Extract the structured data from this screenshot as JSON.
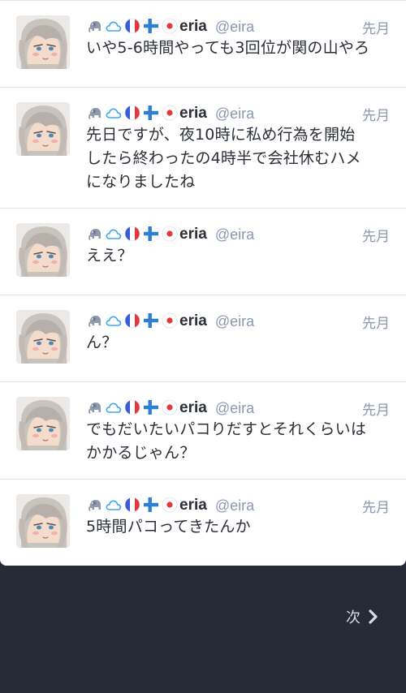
{
  "posts": [
    {
      "display_name": "eria",
      "account": "@eira",
      "time": "先月",
      "lines": [
        "いや5-6時間やっても3回位が関の山やろ"
      ],
      "emojis": [
        "elephant-icon",
        "cloud-icon",
        "france-flag-icon",
        "finland-flag-icon",
        "japan-flag-icon"
      ]
    },
    {
      "display_name": "eria",
      "account": "@eira",
      "time": "先月",
      "lines": [
        "先日ですが、夜10時に私め行為を開始",
        "したら終わったの4時半で会社休むハメ",
        "になりましたね"
      ],
      "emojis": [
        "elephant-icon",
        "cloud-icon",
        "france-flag-icon",
        "finland-flag-icon",
        "japan-flag-icon"
      ]
    },
    {
      "display_name": "eria",
      "account": "@eira",
      "time": "先月",
      "lines": [
        "ええ？"
      ],
      "emojis": [
        "elephant-icon",
        "cloud-icon",
        "france-flag-icon",
        "finland-flag-icon",
        "japan-flag-icon"
      ]
    },
    {
      "display_name": "eria",
      "account": "@eira",
      "time": "先月",
      "lines": [
        "ん？"
      ],
      "emojis": [
        "elephant-icon",
        "cloud-icon",
        "france-flag-icon",
        "finland-flag-icon",
        "japan-flag-icon"
      ]
    },
    {
      "display_name": "eria",
      "account": "@eira",
      "time": "先月",
      "lines": [
        "でもだいたいパコりだすとそれくらいは",
        "かかるじゃん？"
      ],
      "emojis": [
        "elephant-icon",
        "cloud-icon",
        "france-flag-icon",
        "finland-flag-icon",
        "japan-flag-icon"
      ]
    },
    {
      "display_name": "eria",
      "account": "@eira",
      "time": "先月",
      "lines": [
        "5時間パコってきたんか"
      ],
      "emojis": [
        "elephant-icon",
        "cloud-icon",
        "france-flag-icon",
        "finland-flag-icon",
        "japan-flag-icon"
      ]
    }
  ],
  "pagination": {
    "next_label": "次"
  },
  "colors": {
    "background": "#262b36",
    "card": "#ffffff",
    "text": "#2a2e36",
    "muted": "#8a98b4",
    "divider": "#e1e4e8"
  }
}
